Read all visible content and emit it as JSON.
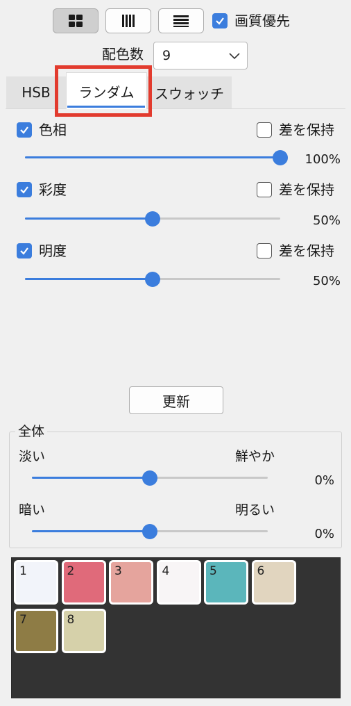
{
  "toolbar": {
    "view_buttons": [
      {
        "icon": "grid-icon",
        "active": true
      },
      {
        "icon": "vertical-bars-icon",
        "active": false
      },
      {
        "icon": "horizontal-lines-icon",
        "active": false
      }
    ],
    "quality_checked": true,
    "quality_label": "画質優先"
  },
  "color_count": {
    "label": "配色数",
    "value": "9"
  },
  "tabs": [
    {
      "label": "HSB",
      "active": false
    },
    {
      "label": "ランダム",
      "active": true
    },
    {
      "label": "スウォッチ",
      "active": false
    }
  ],
  "sliders": [
    {
      "label": "色相",
      "checked": true,
      "keep_diff_label": "差を保持",
      "keep_diff": false,
      "value": 1.0,
      "value_label": "100%"
    },
    {
      "label": "彩度",
      "checked": true,
      "keep_diff_label": "差を保持",
      "keep_diff": false,
      "value": 0.5,
      "value_label": "50%"
    },
    {
      "label": "明度",
      "checked": true,
      "keep_diff_label": "差を保持",
      "keep_diff": false,
      "value": 0.5,
      "value_label": "50%"
    }
  ],
  "update_button": "更新",
  "overall": {
    "title": "全体",
    "vividness": {
      "left": "淡い",
      "right": "鮮やか",
      "value": 0.5,
      "value_label": "0%"
    },
    "brightness": {
      "left": "暗い",
      "right": "明るい",
      "value": 0.5,
      "value_label": "0%"
    }
  },
  "colors": {
    "accent": "#3b7ddd",
    "track_filled": "#3b7ddd",
    "track_empty": "#c8c8c8",
    "highlight": "#e23b2e"
  },
  "swatches": [
    {
      "num": "1",
      "color": "#f2f4fa"
    },
    {
      "num": "2",
      "color": "#e06a7a"
    },
    {
      "num": "3",
      "color": "#e5a49d"
    },
    {
      "num": "4",
      "color": "#f8f5f6"
    },
    {
      "num": "5",
      "color": "#5bb6bb"
    },
    {
      "num": "6",
      "color": "#e1d5bf"
    },
    {
      "num": "7",
      "color": "#8e7c45"
    },
    {
      "num": "8",
      "color": "#d6d1aa"
    }
  ]
}
